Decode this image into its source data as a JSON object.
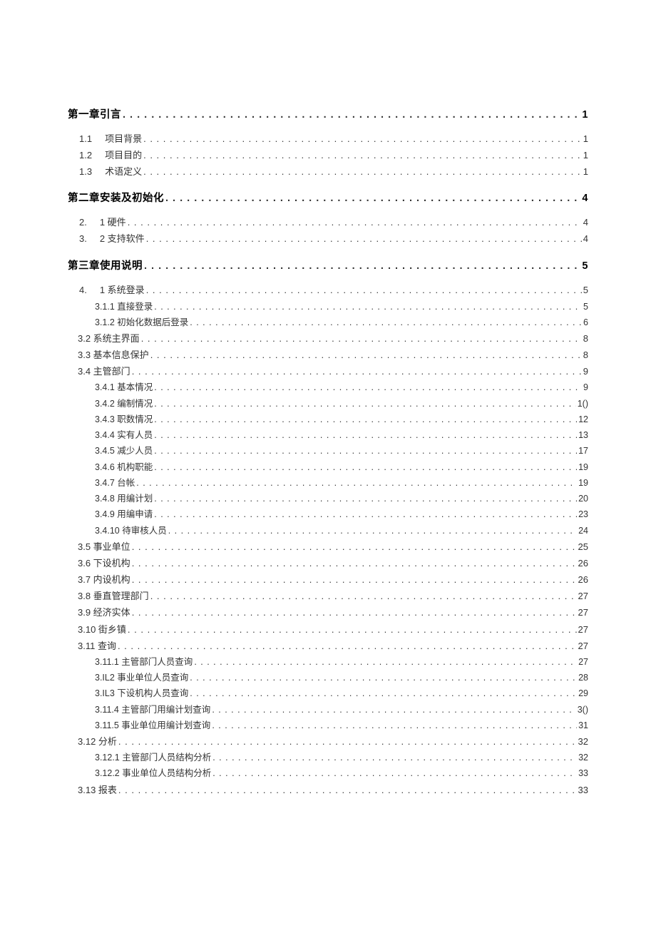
{
  "toc": [
    {
      "level": 0,
      "label": "第一章引言",
      "page": "1"
    },
    {
      "level": 1,
      "num": "1.1",
      "label": "项目背景",
      "page": "1"
    },
    {
      "level": 1,
      "num": "1.2",
      "label": "项目目的",
      "page": "1"
    },
    {
      "level": 1,
      "num": "1.3",
      "label": "术语定义",
      "page": "1"
    },
    {
      "level": 0,
      "label": "第二章安装及初始化",
      "page": "4"
    },
    {
      "level": 1,
      "num": "2.",
      "label": "1 硬件",
      "page": "4"
    },
    {
      "level": 1,
      "num": "3.",
      "label": "2 支持软件",
      "page": "4"
    },
    {
      "level": 0,
      "label": "第三章使用说明",
      "page": "5"
    },
    {
      "level": 1,
      "num": "4.",
      "label": "1 系统登录",
      "page": "5"
    },
    {
      "level": 2,
      "label": "3.1.1 直接登录",
      "page": "5"
    },
    {
      "level": 2,
      "label": "3.1.2 初始化数据后登录",
      "page": "6"
    },
    {
      "level": "1a",
      "label": "3.2 系统主界面",
      "page": "8"
    },
    {
      "level": "1a",
      "label": "3.3 基本信息保护",
      "page": "8"
    },
    {
      "level": "1a",
      "label": "3.4 主管部门",
      "page": "9"
    },
    {
      "level": 2,
      "label": "3.4.1 基本情况",
      "page": "9"
    },
    {
      "level": 2,
      "label": "3.4.2 编制情况",
      "page": "1()"
    },
    {
      "level": 2,
      "label": "3.4.3 职数情况",
      "page": "12"
    },
    {
      "level": 2,
      "label": "3.4.4 实有人员",
      "page": "13"
    },
    {
      "level": 2,
      "label": "3.4.5 减少人员",
      "page": "17"
    },
    {
      "level": 2,
      "label": "3.4.6 机构职能",
      "page": "19"
    },
    {
      "level": 2,
      "label": "3.4.7 台帐",
      "page": "19"
    },
    {
      "level": 2,
      "label": "3.4.8 用编计划",
      "page": "20"
    },
    {
      "level": 2,
      "label": "3.4.9 用编申请",
      "page": "23"
    },
    {
      "level": 2,
      "label": "3.4.10 待审核人员",
      "page": "24"
    },
    {
      "level": "1a",
      "label": "3.5 事业单位",
      "page": "25"
    },
    {
      "level": "1a",
      "label": "3.6 下设机构",
      "page": "26"
    },
    {
      "level": "1a",
      "label": "3.7 内设机构",
      "page": "26"
    },
    {
      "level": "1a",
      "label": "3.8 垂直管理部门",
      "page": "27"
    },
    {
      "level": "1a",
      "label": "3.9 经济实体",
      "page": "27"
    },
    {
      "level": "1a",
      "label": "3.10 街乡镇",
      "page": "27"
    },
    {
      "level": "1a",
      "label": "3.11 查询",
      "page": "27"
    },
    {
      "level": 2,
      "label": "3.11.1 主管部门人员查询",
      "page": "27"
    },
    {
      "level": 2,
      "label": "3.IL2 事业单位人员查询",
      "page": "28"
    },
    {
      "level": 2,
      "label": "3.IL3 下设机构人员查询",
      "page": "29"
    },
    {
      "level": 2,
      "label": "3.11.4 主管部门用编计划查询",
      "page": "3()"
    },
    {
      "level": 2,
      "label": "3.11.5 事业单位用编计划查询",
      "page": "31"
    },
    {
      "level": "1a",
      "label": "3.12 分析",
      "page": "32"
    },
    {
      "level": 2,
      "label": "3.12.1 主管部门人员结构分析",
      "page": "32"
    },
    {
      "level": 2,
      "label": "3.12.2 事业单位人员结构分析",
      "page": "33"
    },
    {
      "level": "1a",
      "label": "3.13 报表",
      "page": "33"
    }
  ]
}
